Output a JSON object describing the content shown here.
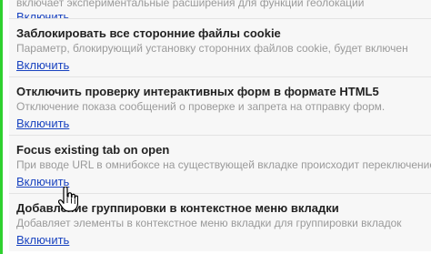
{
  "experiments": [
    {
      "title": "",
      "description": "включает экспериментальные расширения для функций геолокации",
      "link": "Включить"
    },
    {
      "title": "Заблокировать все сторонние файлы cookie",
      "description": "Параметр, блокирующий установку сторонних файлов cookie, будет включен",
      "link": "Включить"
    },
    {
      "title": "Отключить проверку интерактивных форм в формате HTML5",
      "description": "Отключение показа сообщений о проверке и запрета на отправку форм.",
      "link": "Включить"
    },
    {
      "title": "Focus existing tab on open",
      "description": "При вводе URL в омнибоксе на существующей вкладке происходит переключение",
      "link": "Включить"
    },
    {
      "title": "Добавление группировки в контекстное меню вкладки",
      "description": "Добавляет элементы в контекстное меню вкладки для группировки вкладок",
      "link": "Включить"
    }
  ],
  "colors": {
    "accent_left_bar": "#2fd12f",
    "link": "#1a44c0",
    "title": "#222222",
    "description": "#9a9a9a",
    "row_background": "#f7f7f7"
  },
  "icons": {
    "cursor": "hand-pointer-icon"
  }
}
